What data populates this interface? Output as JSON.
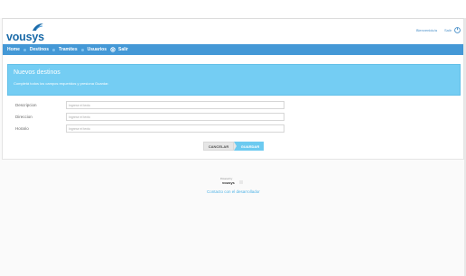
{
  "header": {
    "logo_text": "vousys",
    "welcome_label": "Bienvenido/a",
    "logout_label": "Salir"
  },
  "nav": {
    "items": [
      {
        "label": "Home"
      },
      {
        "label": "Destinos"
      },
      {
        "label": "Tramites"
      },
      {
        "label": "Usuarios"
      },
      {
        "label": "Salir"
      }
    ]
  },
  "banner": {
    "title": "Nuevos destinos",
    "subtitle": "Completá todos los campos requeridos y presiona Guardar."
  },
  "form": {
    "fields": [
      {
        "label": "Descripcion",
        "placeholder": "Ingrese el texto"
      },
      {
        "label": "Direccion",
        "placeholder": "Ingrese el texto"
      },
      {
        "label": "Horario",
        "placeholder": "Ingrese el texto"
      }
    ],
    "cancel_label": "CANCELAR",
    "save_label": "GUARDAR"
  },
  "footer": {
    "credit_small": "Powered by",
    "credit_brand": "vousys",
    "contact_label": "Contacto con el desarrollador"
  },
  "colors": {
    "nav_bg": "#4498d6",
    "banner_bg": "#74cdf3",
    "save_bg": "#6ccaf0",
    "logo": "#1a6aa8"
  }
}
